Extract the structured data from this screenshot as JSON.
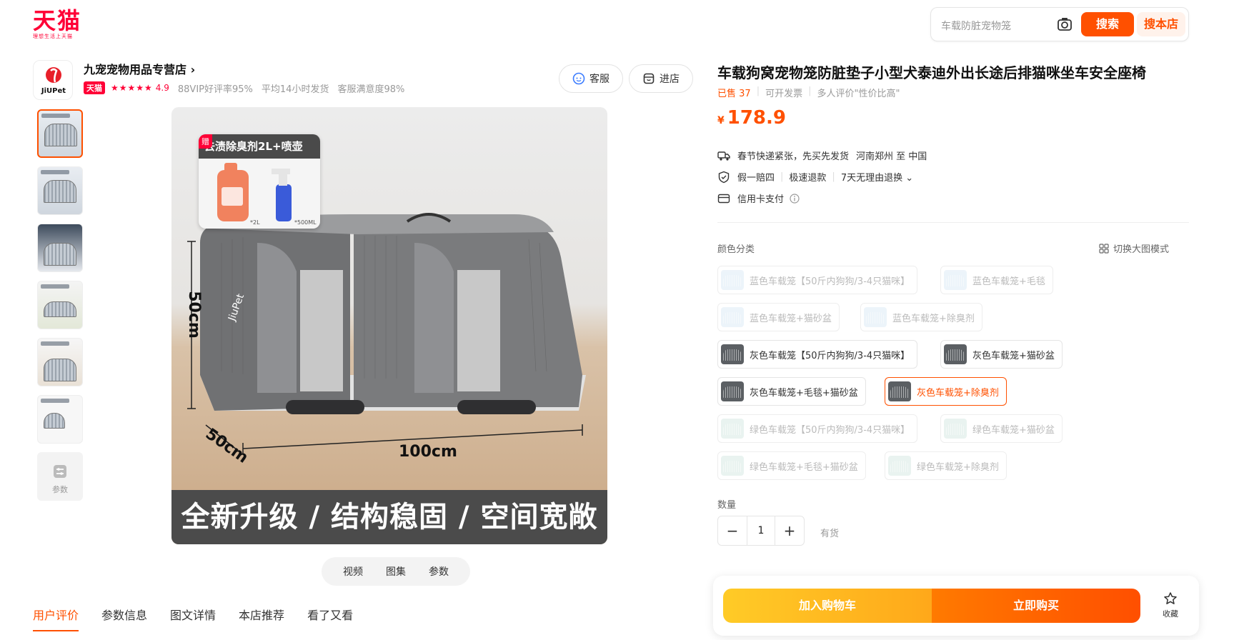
{
  "header": {
    "logo_text": "天猫",
    "logo_sub": "理想生活上天猫",
    "search_placeholder": "车载防脏宠物笼",
    "search_button": "搜索",
    "search_store_button": "搜本店"
  },
  "shop": {
    "name": "九宠宠物用品专营店 ›",
    "badge": "天猫",
    "stars": "★★★★★",
    "rating": "4.9",
    "meta": [
      "88VIP好评率95%",
      "平均14小时发货",
      "客服满意度98%"
    ],
    "service_button": "客服",
    "enter_button": "进店",
    "logo_brand": "JiUPet"
  },
  "gallery": {
    "param_label": "参数",
    "gift_tag": "赠",
    "gift_title": "去渍除臭剂2L+喷壶",
    "gift_vol1": "*2L",
    "gift_vol2": "*500ML",
    "dim_height": "50cm",
    "dim_depth": "50cm",
    "dim_width": "100cm",
    "brand_on_cage": "JiuPet",
    "banner": "全新升级 / 结构稳固 / 空间宽敞",
    "media_tabs": [
      "视频",
      "图集",
      "参数"
    ]
  },
  "bottom_tabs": [
    "用户评价",
    "参数信息",
    "图文详情",
    "本店推荐",
    "看了又看"
  ],
  "product": {
    "title": "车载狗窝宠物笼防脏垫子小型犬泰迪外出长途后排猫咪坐车安全座椅",
    "sold": "已售 37",
    "invoice": "可开发票",
    "review": "多人评价\"性价比高\"",
    "currency": "¥",
    "price": "178.9",
    "shipping": "春节快递紧张，先买先发货",
    "route": "河南郑州 至 中国",
    "guarantees": [
      "假一赔四",
      "极速退款",
      "7天无理由退换 ⌄"
    ],
    "payment": "信用卡支付"
  },
  "sku": {
    "label": "颜色分类",
    "switch_mode": "切换大图模式",
    "options": [
      {
        "label": "蓝色车载笼【50斤内狗狗/3-4只猫咪】",
        "color": "blue",
        "state": "disabled"
      },
      {
        "label": "蓝色车载笼+毛毯",
        "color": "blue",
        "state": "disabled"
      },
      {
        "label": "蓝色车载笼+猫砂盆",
        "color": "blue",
        "state": "disabled"
      },
      {
        "label": "蓝色车载笼+除臭剂",
        "color": "blue",
        "state": "disabled"
      },
      {
        "label": "灰色车载笼【50斤内狗狗/3-4只猫咪】",
        "color": "grey",
        "state": "normal"
      },
      {
        "label": "灰色车载笼+猫砂盆",
        "color": "grey",
        "state": "normal"
      },
      {
        "label": "灰色车载笼+毛毯+猫砂盆",
        "color": "grey",
        "state": "normal"
      },
      {
        "label": "灰色车载笼+除臭剂",
        "color": "grey",
        "state": "selected"
      },
      {
        "label": "绿色车载笼【50斤内狗狗/3-4只猫咪】",
        "color": "green",
        "state": "disabled"
      },
      {
        "label": "绿色车载笼+猫砂盆",
        "color": "green",
        "state": "disabled"
      },
      {
        "label": "绿色车载笼+毛毯+猫砂盆",
        "color": "green",
        "state": "disabled"
      },
      {
        "label": "绿色车载笼+除臭剂",
        "color": "green",
        "state": "disabled"
      }
    ]
  },
  "quantity": {
    "label": "数量",
    "minus": "−",
    "value": "1",
    "plus": "+",
    "stock": "有货"
  },
  "actions": {
    "cart": "加入购物车",
    "buy": "立即购买",
    "favorite": "收藏"
  },
  "colors": {
    "brand": "#ff0036",
    "accent": "#ff5000"
  }
}
